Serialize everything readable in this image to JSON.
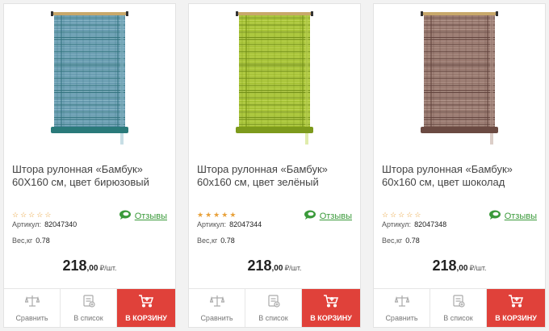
{
  "products": [
    {
      "title": "Штора рулонная «Бамбук» 60Х160 см, цвет бирюзовый",
      "rating_filled": 0,
      "reviews_label": "Отзывы",
      "article_label": "Артикул:",
      "article": "82047340",
      "weight_label": "Вес,кг",
      "weight": "0.78",
      "price_int": "218",
      "price_dec": ",00",
      "price_unit": "₽/шт.",
      "compare_label": "Сравнить",
      "wishlist_label": "В список",
      "cart_label": "В КОРЗИНУ",
      "colors": {
        "main": "#5a8fa6",
        "dark": "#2f6f7c",
        "light": "#8fbccb",
        "roll": "#2a7a7a"
      }
    },
    {
      "title": "Штора рулонная «Бамбук» 60х160 см, цвет зелёный",
      "rating_filled": 5,
      "reviews_label": "Отзывы",
      "article_label": "Артикул:",
      "article": "82047344",
      "weight_label": "Вес,кг",
      "weight": "0.78",
      "price_int": "218",
      "price_dec": ",00",
      "price_unit": "₽/шт.",
      "compare_label": "Сравнить",
      "wishlist_label": "В список",
      "cart_label": "В КОРЗИНУ",
      "colors": {
        "main": "#9dbb2a",
        "dark": "#6f8d12",
        "light": "#c2d85a",
        "roll": "#7d9a1c"
      }
    },
    {
      "title": "Штора рулонная «Бамбук» 60х160 см, цвет шоколад",
      "rating_filled": 0,
      "reviews_label": "Отзывы",
      "article_label": "Артикул:",
      "article": "82047348",
      "weight_label": "Вес,кг",
      "weight": "0.78",
      "price_int": "218",
      "price_dec": ",00",
      "price_unit": "₽/шт.",
      "compare_label": "Сравнить",
      "wishlist_label": "В список",
      "cart_label": "В КОРЗИНУ",
      "colors": {
        "main": "#8a6a60",
        "dark": "#5e3f38",
        "light": "#b89c92",
        "roll": "#6b4a42"
      }
    }
  ],
  "icons": {
    "star": "star-icon",
    "reviews": "speech-bubble-icon",
    "compare": "scales-icon",
    "wishlist": "list-icon",
    "cart": "cart-icon"
  },
  "accent": {
    "star": "#e8a13a",
    "reviews": "#3a9a3a",
    "cart_bg": "#e0413a"
  }
}
